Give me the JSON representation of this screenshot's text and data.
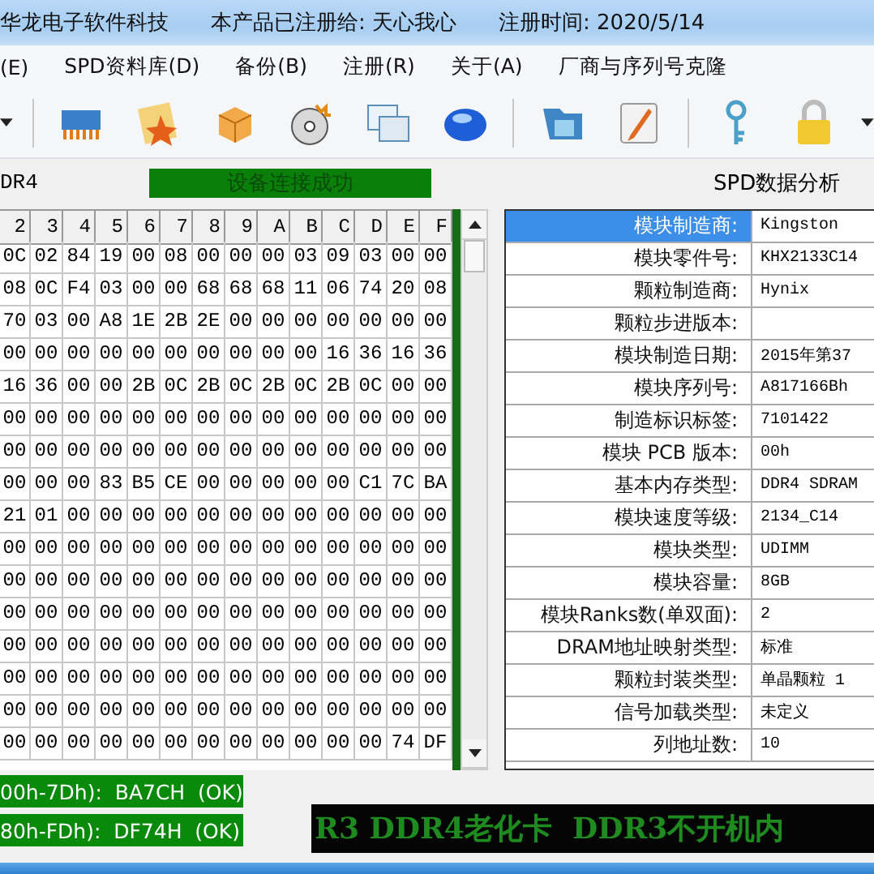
{
  "title_bar": {
    "texts": [
      "华龙电子软件科技",
      "本产品已注册给: 天心我心",
      "注册时间: 2020/5/14"
    ]
  },
  "menu": [
    {
      "label": "(E)"
    },
    {
      "label": "SPD资料库(D)"
    },
    {
      "label": "备份(B)"
    },
    {
      "label": "注册(R)"
    },
    {
      "label": "关于(A)"
    },
    {
      "label": "厂商与序列号克隆"
    }
  ],
  "status_row": {
    "type_label": "DR4",
    "connection": "设备连接成功",
    "analysis_title": "SPD数据分析"
  },
  "hex_table": {
    "columns": [
      "2",
      "3",
      "4",
      "5",
      "6",
      "7",
      "8",
      "9",
      "A",
      "B",
      "C",
      "D",
      "E",
      "F"
    ],
    "rows": [
      [
        "0C",
        "02",
        "84",
        "19",
        "00",
        "08",
        "00",
        "00",
        "00",
        "03",
        "09",
        "03",
        "00",
        "00"
      ],
      [
        "08",
        "0C",
        "F4",
        "03",
        "00",
        "00",
        "68",
        "68",
        "68",
        "11",
        "06",
        "74",
        "20",
        "08"
      ],
      [
        "70",
        "03",
        "00",
        "A8",
        "1E",
        "2B",
        "2E",
        "00",
        "00",
        "00",
        "00",
        "00",
        "00",
        "00"
      ],
      [
        "00",
        "00",
        "00",
        "00",
        "00",
        "00",
        "00",
        "00",
        "00",
        "00",
        "16",
        "36",
        "16",
        "36"
      ],
      [
        "16",
        "36",
        "00",
        "00",
        "2B",
        "0C",
        "2B",
        "0C",
        "2B",
        "0C",
        "2B",
        "0C",
        "00",
        "00"
      ],
      [
        "00",
        "00",
        "00",
        "00",
        "00",
        "00",
        "00",
        "00",
        "00",
        "00",
        "00",
        "00",
        "00",
        "00"
      ],
      [
        "00",
        "00",
        "00",
        "00",
        "00",
        "00",
        "00",
        "00",
        "00",
        "00",
        "00",
        "00",
        "00",
        "00"
      ],
      [
        "00",
        "00",
        "00",
        "83",
        "B5",
        "CE",
        "00",
        "00",
        "00",
        "00",
        "00",
        "C1",
        "7C",
        "BA"
      ],
      [
        "21",
        "01",
        "00",
        "00",
        "00",
        "00",
        "00",
        "00",
        "00",
        "00",
        "00",
        "00",
        "00",
        "00"
      ],
      [
        "00",
        "00",
        "00",
        "00",
        "00",
        "00",
        "00",
        "00",
        "00",
        "00",
        "00",
        "00",
        "00",
        "00"
      ],
      [
        "00",
        "00",
        "00",
        "00",
        "00",
        "00",
        "00",
        "00",
        "00",
        "00",
        "00",
        "00",
        "00",
        "00"
      ],
      [
        "00",
        "00",
        "00",
        "00",
        "00",
        "00",
        "00",
        "00",
        "00",
        "00",
        "00",
        "00",
        "00",
        "00"
      ],
      [
        "00",
        "00",
        "00",
        "00",
        "00",
        "00",
        "00",
        "00",
        "00",
        "00",
        "00",
        "00",
        "00",
        "00"
      ],
      [
        "00",
        "00",
        "00",
        "00",
        "00",
        "00",
        "00",
        "00",
        "00",
        "00",
        "00",
        "00",
        "00",
        "00"
      ],
      [
        "00",
        "00",
        "00",
        "00",
        "00",
        "00",
        "00",
        "00",
        "00",
        "00",
        "00",
        "00",
        "00",
        "00"
      ],
      [
        "00",
        "00",
        "00",
        "00",
        "00",
        "00",
        "00",
        "00",
        "00",
        "00",
        "00",
        "00",
        "74",
        "DF"
      ]
    ]
  },
  "spd_table": [
    {
      "label": "模块制造商:",
      "value": "Kingston",
      "selected": true
    },
    {
      "label": "模块零件号:",
      "value": "KHX2133C14",
      "selected": false
    },
    {
      "label": "颗粒制造商:",
      "value": "Hynix",
      "selected": false
    },
    {
      "label": "颗粒步进版本:",
      "selected": false
    },
    {
      "label": "模块制造日期:",
      "value": "2015年第37",
      "selected": false
    },
    {
      "label": "模块序列号:",
      "value": "A817166Bh",
      "selected": false
    },
    {
      "label": "制造标识标签:",
      "value": "7101422",
      "selected": false
    },
    {
      "label": "模块 PCB 版本:",
      "value": "00h",
      "selected": false
    },
    {
      "label": "基本内存类型:",
      "value": "DDR4 SDRAM",
      "selected": false
    },
    {
      "label": "模块速度等级:",
      "value": "2134_C14",
      "selected": false
    },
    {
      "label": "模块类型:",
      "value": "UDIMM",
      "selected": false
    },
    {
      "label": "模块容量:",
      "value": "8GB",
      "selected": false
    },
    {
      "label": "模块Ranks数(单双面):",
      "value": "2",
      "selected": false
    },
    {
      "label": "DRAM地址映射类型:",
      "value": "标准",
      "selected": false
    },
    {
      "label": "颗粒封装类型:",
      "value": "单晶颗粒 1",
      "selected": false
    },
    {
      "label": "信号加载类型:",
      "value": "未定义",
      "selected": false
    },
    {
      "label": "列地址数:",
      "value": "10",
      "selected": false
    }
  ],
  "checksums": [
    "00h-7Dh):  BA7CH  (OK)",
    "80h-FDh):  DF74H  (OK)"
  ],
  "marquee": "R3 DDR4老化卡  DDR3不开机内"
}
